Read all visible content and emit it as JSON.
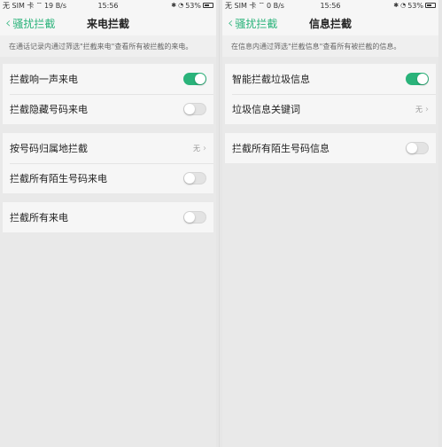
{
  "left": {
    "status": {
      "sim": "无 SIM 卡",
      "speed": "19 B/s",
      "time": "15:56",
      "battery": "53%"
    },
    "nav": {
      "back_label": "骚扰拦截",
      "title": "来电拦截"
    },
    "description": "在通话记录内通过筛选\"拦截来电\"查看所有被拦截的来电。",
    "groups": [
      {
        "items": [
          {
            "label": "拦截响一声来电",
            "toggle": true
          },
          {
            "label": "拦截隐藏号码来电",
            "toggle": false
          }
        ]
      },
      {
        "items": [
          {
            "label": "按号码归属地拦截",
            "value": "无"
          },
          {
            "label": "拦截所有陌生号码来电",
            "toggle": false
          }
        ]
      },
      {
        "items": [
          {
            "label": "拦截所有来电",
            "toggle": false
          }
        ]
      }
    ]
  },
  "right": {
    "status": {
      "sim": "无 SIM 卡",
      "speed": "0 B/s",
      "time": "15:56",
      "battery": "53%"
    },
    "nav": {
      "back_label": "骚扰拦截",
      "title": "信息拦截"
    },
    "description": "在信息内通过筛选\"拦截信息\"查看所有被拦截的信息。",
    "groups": [
      {
        "items": [
          {
            "label": "智能拦截垃圾信息",
            "toggle": true
          },
          {
            "label": "垃圾信息关键词",
            "value": "无"
          }
        ]
      },
      {
        "items": [
          {
            "label": "拦截所有陌生号码信息",
            "toggle": false
          }
        ]
      }
    ]
  },
  "colors": {
    "accent": "#2ab37a",
    "toggle_off": "#e3e3e3",
    "background": "#e9e9e9"
  },
  "icons": {
    "back": "chevron-left-icon",
    "wifi": "wifi-icon",
    "battery": "battery-icon",
    "bluetooth": "bluetooth-icon",
    "alarm": "alarm-icon",
    "chevron_right": "chevron-right-icon"
  }
}
